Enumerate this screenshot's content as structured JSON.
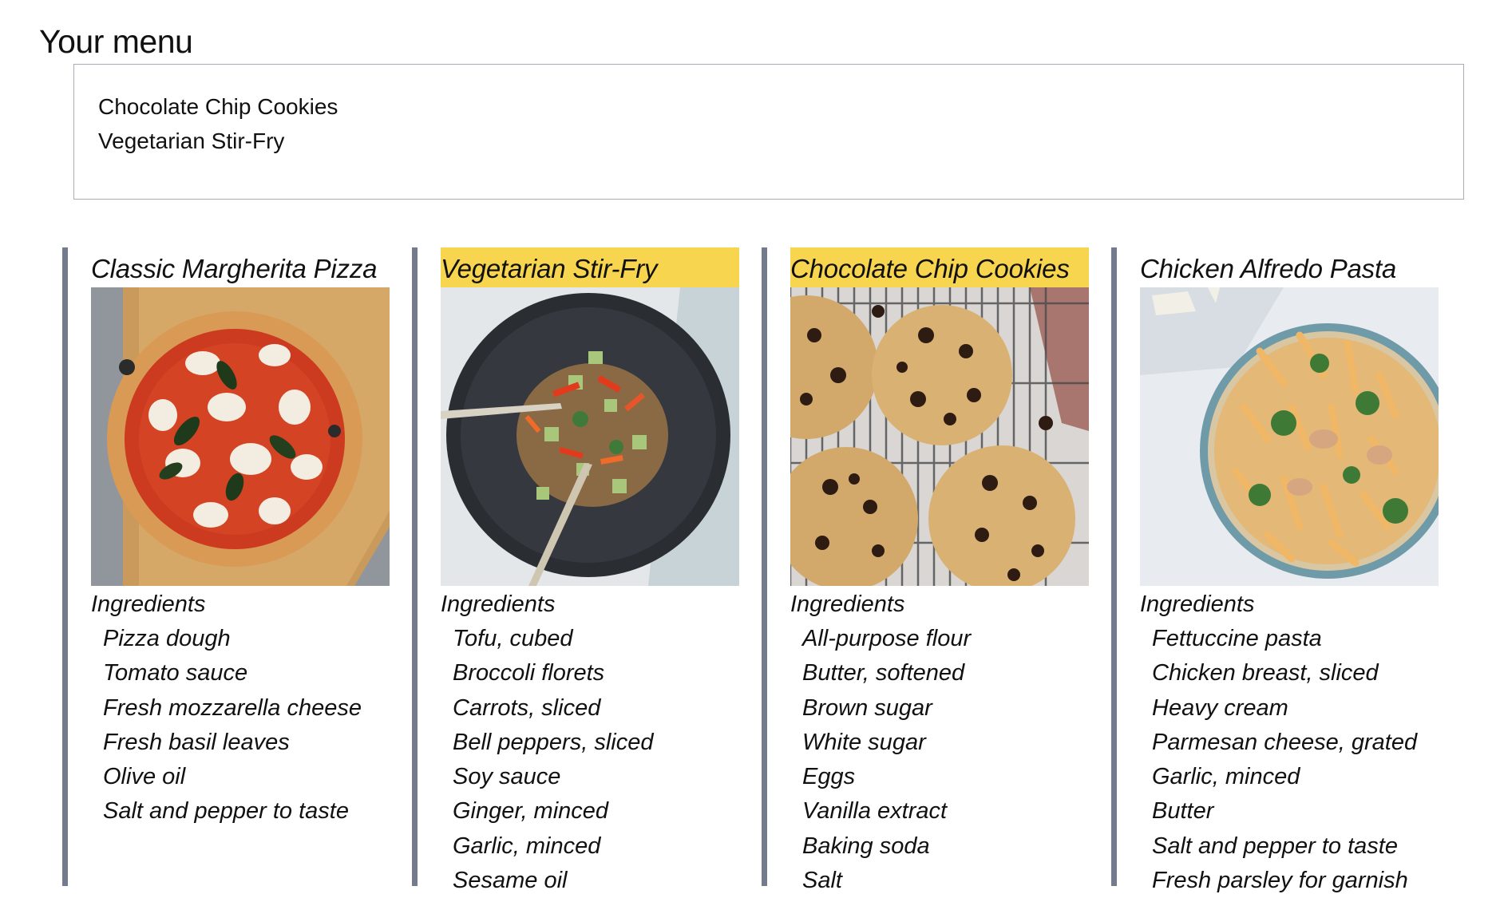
{
  "header": {
    "title": "Your menu"
  },
  "menu": {
    "items": [
      "Chocolate Chip Cookies",
      "Vegetarian Stir-Fry"
    ]
  },
  "colors": {
    "selected_highlight": "#f7d54f",
    "card_border": "#737b8c",
    "menu_box_border": "#a9acb4"
  },
  "recipes": [
    {
      "title": "Classic Margherita Pizza",
      "selected": false,
      "image": "pizza-photo",
      "ingredients_heading": "Ingredients",
      "ingredients": [
        "Pizza dough",
        "Tomato sauce",
        "Fresh mozzarella cheese",
        "Fresh basil leaves",
        "Olive oil",
        "Salt and pepper to taste"
      ]
    },
    {
      "title": "Vegetarian Stir-Fry",
      "selected": true,
      "image": "stir-fry-photo",
      "ingredients_heading": "Ingredients",
      "ingredients": [
        "Tofu, cubed",
        "Broccoli florets",
        "Carrots, sliced",
        "Bell peppers, sliced",
        "Soy sauce",
        "Ginger, minced",
        "Garlic, minced",
        "Sesame oil"
      ]
    },
    {
      "title": "Chocolate Chip Cookies",
      "selected": true,
      "image": "cookies-photo",
      "ingredients_heading": "Ingredients",
      "ingredients": [
        "All-purpose flour",
        "Butter, softened",
        "Brown sugar",
        "White sugar",
        "Eggs",
        "Vanilla extract",
        "Baking soda",
        "Salt"
      ]
    },
    {
      "title": "Chicken Alfredo Pasta",
      "selected": false,
      "image": "pasta-photo",
      "ingredients_heading": "Ingredients",
      "ingredients": [
        "Fettuccine pasta",
        "Chicken breast, sliced",
        "Heavy cream",
        "Parmesan cheese, grated",
        "Garlic, minced",
        "Butter",
        "Salt and pepper to taste",
        "Fresh parsley for garnish"
      ]
    }
  ]
}
